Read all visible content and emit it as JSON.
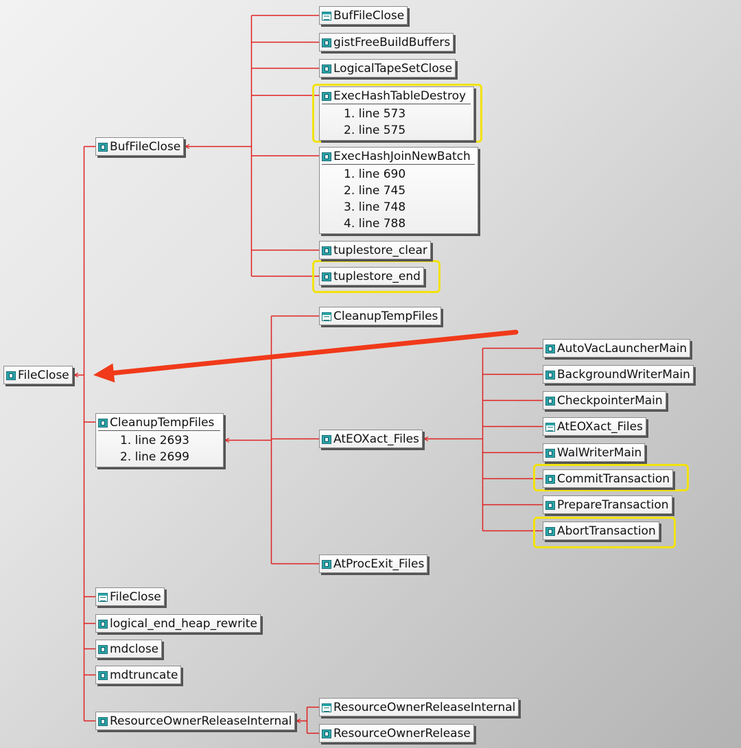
{
  "nodes": [
    {
      "id": "fileclose-root",
      "label": "FileClose",
      "icon": "function-icon"
    },
    {
      "id": "buffileclose",
      "label": "BufFileClose",
      "icon": "function-icon"
    },
    {
      "id": "buffileclose-caller",
      "label": "BufFileClose",
      "icon": "file-icon"
    },
    {
      "id": "gistfreebuildbuffers",
      "label": "gistFreeBuildBuffers",
      "icon": "function-icon"
    },
    {
      "id": "logicaltapesetclose",
      "label": "LogicalTapeSetClose",
      "icon": "function-icon"
    },
    {
      "id": "exechashtabledestroy",
      "label": "ExecHashTableDestroy",
      "icon": "function-icon",
      "lines": [
        "1. line 573",
        "2. line 575"
      ]
    },
    {
      "id": "exechashjoinnewbatch",
      "label": "ExecHashJoinNewBatch",
      "icon": "function-icon",
      "lines": [
        "1. line 690",
        "2. line 745",
        "3. line 748",
        "4. line 788"
      ]
    },
    {
      "id": "tuplestore-clear",
      "label": "tuplestore_clear",
      "icon": "function-icon"
    },
    {
      "id": "tuplestore-end",
      "label": "tuplestore_end",
      "icon": "function-icon"
    },
    {
      "id": "cleanuptempfiles",
      "label": "CleanupTempFiles",
      "icon": "function-icon",
      "lines": [
        "1. line 2693",
        "2. line 2699"
      ]
    },
    {
      "id": "cleanuptempfiles-caller",
      "label": "CleanupTempFiles",
      "icon": "file-icon"
    },
    {
      "id": "ateoxact-files",
      "label": "AtEOXact_Files",
      "icon": "function-icon"
    },
    {
      "id": "atprocexit-files",
      "label": "AtProcExit_Files",
      "icon": "function-icon"
    },
    {
      "id": "autovaclaunchermain",
      "label": "AutoVacLauncherMain",
      "icon": "function-icon"
    },
    {
      "id": "backgroundwritermain",
      "label": "BackgroundWriterMain",
      "icon": "function-icon"
    },
    {
      "id": "checkpointermain",
      "label": "CheckpointerMain",
      "icon": "function-icon"
    },
    {
      "id": "ateoxact-files-caller",
      "label": "AtEOXact_Files",
      "icon": "file-icon"
    },
    {
      "id": "walwritermain",
      "label": "WalWriterMain",
      "icon": "function-icon"
    },
    {
      "id": "committransaction",
      "label": "CommitTransaction",
      "icon": "function-icon"
    },
    {
      "id": "preparetransaction",
      "label": "PrepareTransaction",
      "icon": "function-icon"
    },
    {
      "id": "aborttransaction",
      "label": "AbortTransaction",
      "icon": "function-icon"
    },
    {
      "id": "fileclose-caller",
      "label": "FileClose",
      "icon": "file-icon"
    },
    {
      "id": "logical-end-heap-rewrite",
      "label": "logical_end_heap_rewrite",
      "icon": "function-icon"
    },
    {
      "id": "mdclose",
      "label": "mdclose",
      "icon": "function-icon"
    },
    {
      "id": "mdtruncate",
      "label": "mdtruncate",
      "icon": "function-icon"
    },
    {
      "id": "resourceownerreleaseinternal",
      "label": "ResourceOwnerReleaseInternal",
      "icon": "function-icon"
    },
    {
      "id": "resourceownerreleaseinternal-caller",
      "label": "ResourceOwnerReleaseInternal",
      "icon": "file-icon"
    },
    {
      "id": "resourceownerrelease",
      "label": "ResourceOwnerRelease",
      "icon": "function-icon"
    }
  ],
  "edges": [
    {
      "from": "fileclose-root",
      "to": [
        "buffileclose",
        "cleanuptempfiles",
        "fileclose-caller",
        "logical-end-heap-rewrite",
        "mdclose",
        "mdtruncate",
        "resourceownerreleaseinternal"
      ]
    },
    {
      "from": "buffileclose",
      "to": [
        "buffileclose-caller",
        "gistfreebuildbuffers",
        "logicaltapesetclose",
        "exechashtabledestroy",
        "exechashjoinnewbatch",
        "tuplestore-clear",
        "tuplestore-end"
      ]
    },
    {
      "from": "cleanuptempfiles",
      "to": [
        "cleanuptempfiles-caller",
        "ateoxact-files",
        "atprocexit-files"
      ]
    },
    {
      "from": "ateoxact-files",
      "to": [
        "autovaclaunchermain",
        "backgroundwritermain",
        "checkpointermain",
        "ateoxact-files-caller",
        "walwritermain",
        "committransaction",
        "preparetransaction",
        "aborttransaction"
      ]
    },
    {
      "from": "resourceownerreleaseinternal",
      "to": [
        "resourceownerreleaseinternal-caller",
        "resourceownerrelease"
      ]
    }
  ],
  "highlighted": [
    "exechashtabledestroy",
    "tuplestore-end",
    "committransaction",
    "aborttransaction"
  ],
  "colors": {
    "edge": "#e02020",
    "highlight": "#f2e20a",
    "annotation_arrow": "#f03a1a",
    "icon": "#2aa6a9"
  }
}
